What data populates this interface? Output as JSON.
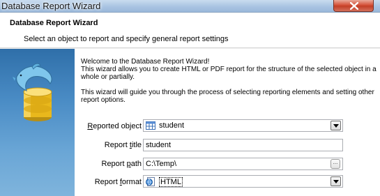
{
  "window": {
    "title": "Database Report Wizard"
  },
  "header": {
    "title": "Database Report Wizard",
    "subtitle": "Select an object to report and specify general report settings"
  },
  "intro": {
    "welcome": "Welcome to the Database Report Wizard!",
    "line1": "This wizard allows you to create HTML or PDF report for the structure of the selected object in a",
    "line2": "whole or partially.",
    "guide1": "This wizard will guide you through the process of selecting reporting elements and setting other",
    "guide2": "report options."
  },
  "form": {
    "reported_object": {
      "label_u": "R",
      "label_rest": "eported object",
      "value": "student",
      "icon": "table-icon"
    },
    "report_title": {
      "label_pre": "Report ",
      "label_u": "t",
      "label_rest": "itle",
      "value": "student"
    },
    "report_path": {
      "label_pre": "Report ",
      "label_u": "p",
      "label_rest": "ath",
      "value": "C:\\Temp\\",
      "button_label": "..."
    },
    "report_format": {
      "label_pre": "Report ",
      "label_u": "f",
      "label_rest": "ormat",
      "value": "HTML",
      "icon": "html-file-icon"
    }
  },
  "colors": {
    "titlebar": "#a9c4e2",
    "close_button": "#d5533b",
    "side_panel": "#4a8cc5"
  }
}
